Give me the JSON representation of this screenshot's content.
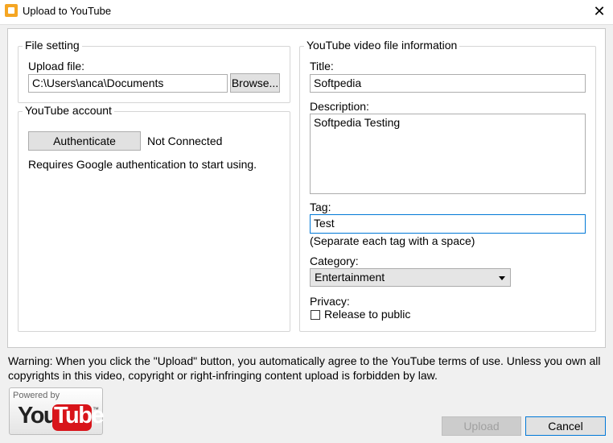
{
  "window": {
    "title": "Upload to YouTube",
    "close_glyph": "✕"
  },
  "file_setting": {
    "group_title": "File setting",
    "upload_label": "Upload file:",
    "upload_value": "C:\\Users\\anca\\Documents",
    "browse_label": "Browse..."
  },
  "account": {
    "group_title": "YouTube account",
    "authenticate_label": "Authenticate",
    "status": "Not Connected",
    "note": "Requires Google authentication to start using."
  },
  "video_info": {
    "group_title": "YouTube video file information",
    "title_label": "Title:",
    "title_value": "Softpedia",
    "description_label": "Description:",
    "description_value": "Softpedia Testing",
    "tag_label": "Tag:",
    "tag_value": "Test",
    "tag_hint": "(Separate each tag with a space)",
    "category_label": "Category:",
    "category_value": "Entertainment",
    "privacy_label": "Privacy:",
    "release_label": "Release to public",
    "release_checked": false
  },
  "warning": {
    "line1": "Warning: When you click the \"Upload\" button, you automatically agree to the YouTube terms of use. Unless you own all",
    "line2": "copyrights in this video, copyright or right-infringing content upload is forbidden by law."
  },
  "branding": {
    "powered_by": "Powered by",
    "you": "You",
    "tube": "Tube",
    "tm": "™"
  },
  "actions": {
    "upload_label": "Upload",
    "cancel_label": "Cancel"
  }
}
